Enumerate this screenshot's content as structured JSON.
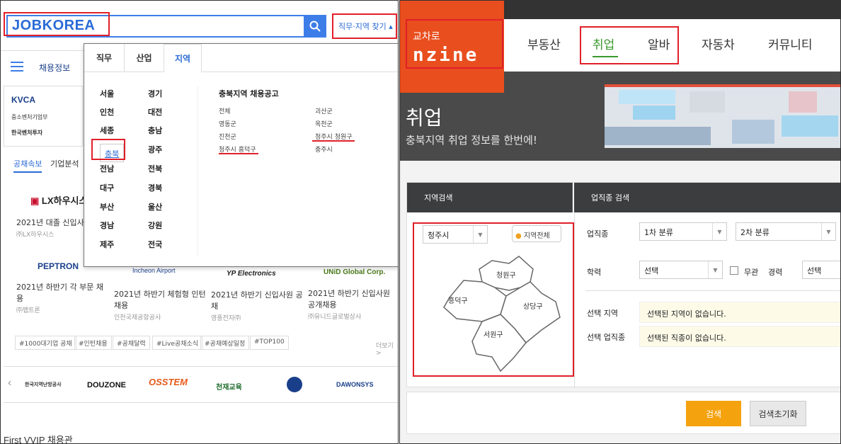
{
  "left": {
    "logo": "JOBKOREA",
    "job_area_button": "직무·지역 찾기",
    "nav_label": "채용정보",
    "tabs2": [
      "공채속보",
      "기업분석"
    ],
    "dropdown": {
      "tabs": [
        "직무",
        "산업",
        "지역"
      ],
      "regions_col1": [
        "서울",
        "인천",
        "세종",
        "충북",
        "전남",
        "대구",
        "부산",
        "경남",
        "제주"
      ],
      "regions_col2": [
        "경기",
        "대전",
        "충남",
        "광주",
        "전북",
        "경북",
        "울산",
        "강원",
        "전국"
      ],
      "selected_region": "충북",
      "subtitle": "충북지역 채용공고",
      "cities_col1": [
        "전체",
        "영동군",
        "진천군",
        "청주시 흥덕구"
      ],
      "cities_col2": [
        "괴산군",
        "옥천군",
        "청주시 청원구",
        "충주시"
      ]
    },
    "listings": [
      {
        "logo": "PEPTRON",
        "title": "2021년 하반기 각 부문 채용",
        "company": "㈜펩트론"
      },
      {
        "logo": "Incheon Airport",
        "title": "2021년 하반기 체험형 인턴 채용",
        "company": "인천국제공항공사"
      },
      {
        "logo": "YP Electronics",
        "title": "2021년 하반기 신입사원 공채",
        "company": "영풍전자㈜"
      },
      {
        "logo": "UNiD Global Corp.",
        "title": "2021년 하반기 신입사원 공개채용",
        "company": "㈜유니드글로벌상사"
      }
    ],
    "top_listing": {
      "logo": "LX하우시스",
      "title": "2021년 대졸 신입사원 수시채용",
      "company": "㈜LX하우시스"
    },
    "tags": [
      "#1000대기업 공채",
      "#인턴채용",
      "#공채달력",
      "#Live공채소식",
      "#공채예상일정",
      "#TOP100"
    ],
    "more": "더보기 >",
    "partner_logos": [
      "한국지역난방공사",
      "DOUZONE",
      "OSSTEM",
      "천재교육",
      "",
      "DAWONSYS"
    ],
    "footer_text": "First VVIP 채용관"
  },
  "right": {
    "brand_small": "교차로",
    "brand_large": "nzine",
    "nav": [
      "부동산",
      "취업",
      "알바",
      "자동차",
      "커뮤니티"
    ],
    "active_nav": "취업",
    "hero_title": "취업",
    "hero_subtitle": "충북지역 취업 정보를 한번에!",
    "region_search_header": "지역검색",
    "job_search_header": "업직종 검색",
    "city_select": "청주시",
    "all_region_button": "지역전체",
    "map_districts": [
      "청원구",
      "흥덕구",
      "상당구",
      "서원구"
    ],
    "labels": {
      "job": "업직종",
      "edu": "학력",
      "career": "경력",
      "sel_region": "선택 지역",
      "sel_job": "선택 업직종",
      "no_matter": "무관"
    },
    "sel_cat1": "1차 분류",
    "sel_cat2": "2차 분류",
    "sel_edu": "선택",
    "sel_career": "선택",
    "no_region": "선택된 지역이 없습니다.",
    "no_job": "선택된 직종이 없습니다.",
    "search_button": "검색",
    "reset_button": "검색초기화"
  }
}
